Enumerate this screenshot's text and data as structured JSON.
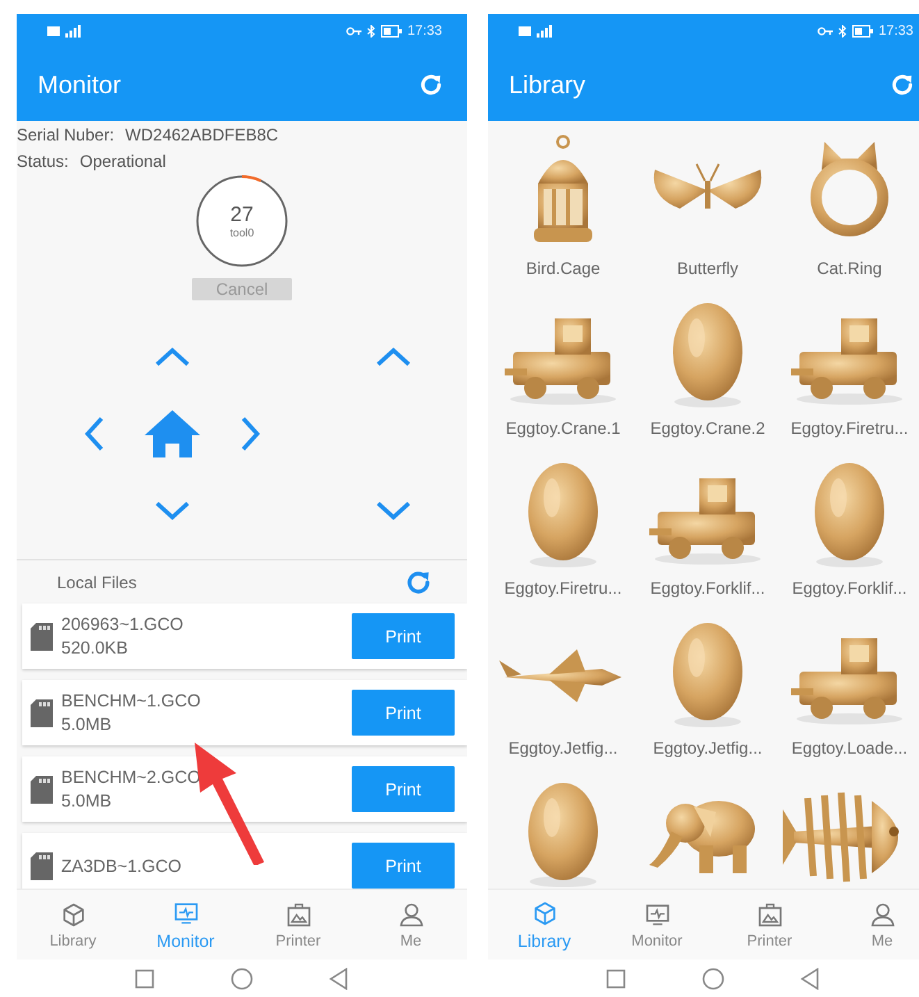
{
  "monitor_screen": {
    "status_bar": {
      "time": "17:33"
    },
    "title": "Monitor",
    "serial_label": "Serial Nuber:",
    "serial_value": "WD2462ABDFEB8C",
    "status_label": "Status:",
    "status_value": "Operational",
    "gauge": {
      "value": "27",
      "label": "tool0",
      "level": 0.07
    },
    "cancel_button": {
      "label": "Cancel",
      "disabled": true
    },
    "local_files": {
      "title": "Local Files",
      "files": [
        {
          "name": "206963~1.GCO",
          "size": "520.0KB",
          "button": "Print"
        },
        {
          "name": "BENCHM~1.GCO",
          "size": "5.0MB",
          "button": "Print"
        },
        {
          "name": "BENCHM~2.GCO",
          "size": "5.0MB",
          "button": "Print"
        },
        {
          "name": "ZA3DB~1.GCO",
          "button": "Print"
        }
      ]
    },
    "nav": [
      {
        "label": "Library",
        "selected": false
      },
      {
        "label": "Monitor",
        "selected": true
      },
      {
        "label": "Printer",
        "selected": false
      },
      {
        "label": "Me",
        "selected": false
      }
    ]
  },
  "library_screen": {
    "status_bar": {
      "time": "17:33"
    },
    "title": "Library",
    "items": [
      {
        "kind": "picture",
        "name": "Bird.Cage"
      },
      {
        "kind": "picture",
        "name": "Butterfly"
      },
      {
        "kind": "picture",
        "name": "Cat.Ring"
      },
      {
        "kind": "picture",
        "name": "Eggtoy.Crane.1"
      },
      {
        "kind": "picture",
        "name": "Eggtoy.Crane.2"
      },
      {
        "kind": "picture",
        "name": "Eggtoy.Firetru..."
      },
      {
        "kind": "picture",
        "name": "Eggtoy.Firetru..."
      },
      {
        "kind": "picture",
        "name": "Eggtoy.Forklif..."
      },
      {
        "kind": "picture",
        "name": "Eggtoy.Forklif..."
      },
      {
        "kind": "picture",
        "name": "Eggtoy.Jetfig..."
      },
      {
        "kind": "picture",
        "name": "Eggtoy.Jetfig..."
      },
      {
        "kind": "picture",
        "name": "Eggtoy.Loade..."
      },
      {
        "kind": "picture"
      },
      {
        "kind": "picture"
      },
      {
        "kind": "picture"
      }
    ],
    "nav": [
      {
        "label": "Library",
        "selected": true
      },
      {
        "label": "Monitor",
        "selected": false
      },
      {
        "label": "Printer",
        "selected": false
      },
      {
        "label": "Me",
        "selected": false
      }
    ]
  }
}
